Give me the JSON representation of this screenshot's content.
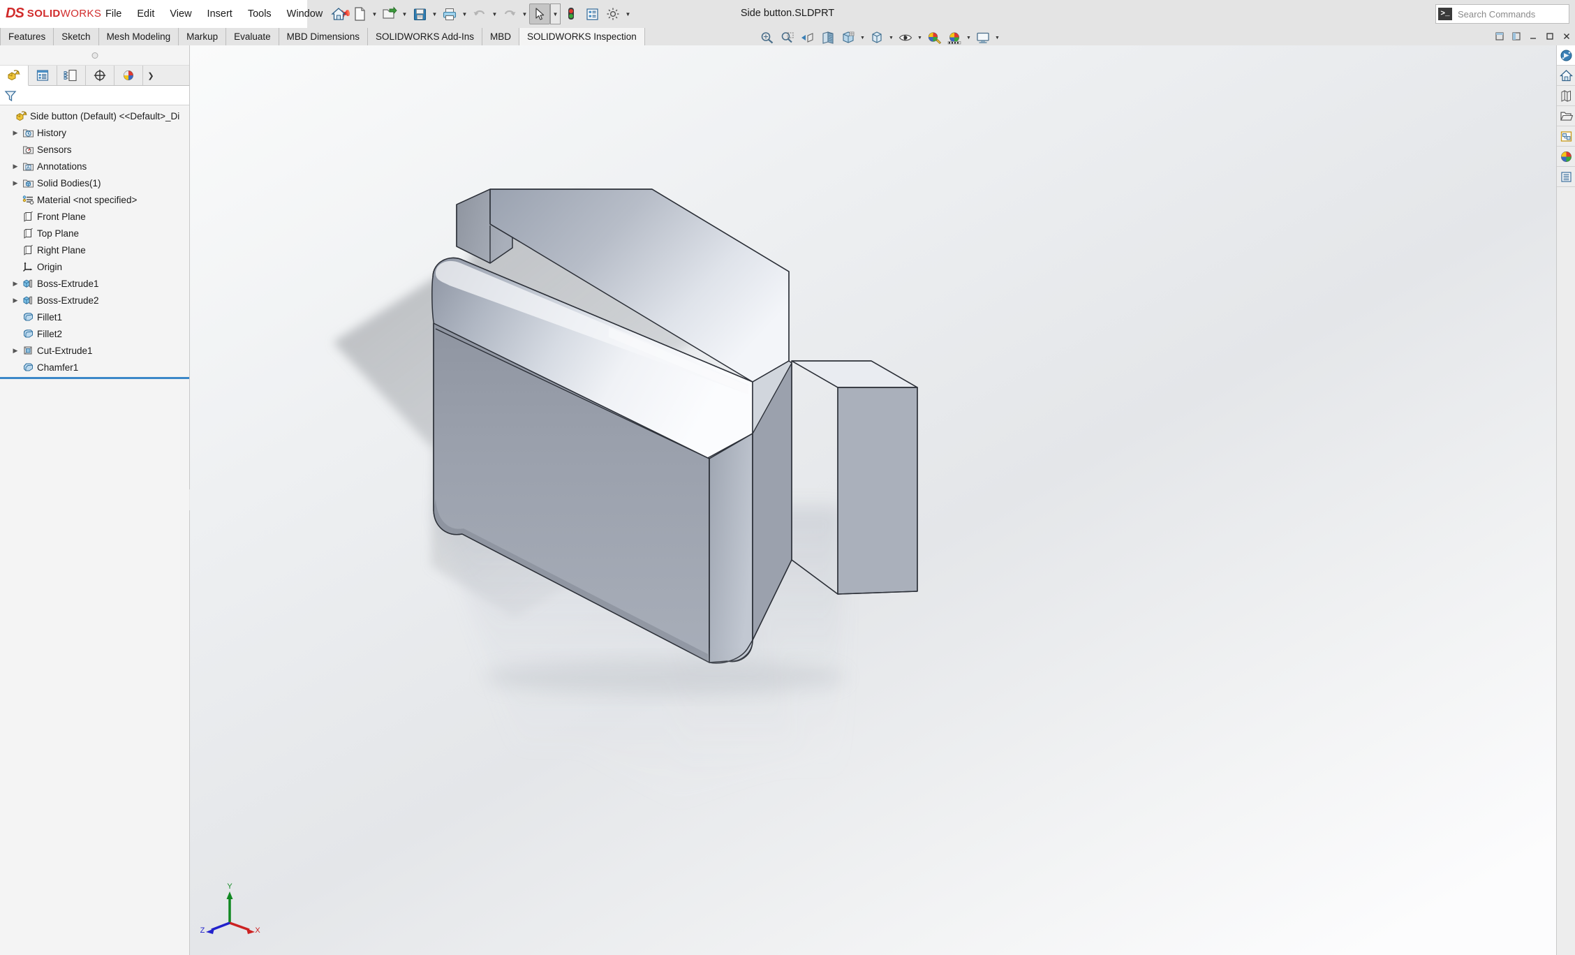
{
  "app": {
    "brand_primary": "DS",
    "brand_bold": "SOLID",
    "brand_thin": "WORKS",
    "document_title": "Side button.SLDPRT",
    "accent_color": "#d12b2b",
    "selection_color": "#3b87c8"
  },
  "menubar": {
    "items": [
      {
        "label": "File",
        "name": "menu-file"
      },
      {
        "label": "Edit",
        "name": "menu-edit"
      },
      {
        "label": "View",
        "name": "menu-view"
      },
      {
        "label": "Insert",
        "name": "menu-insert"
      },
      {
        "label": "Tools",
        "name": "menu-tools"
      },
      {
        "label": "Window",
        "name": "menu-window"
      }
    ],
    "pin_icon": "pushpin-icon"
  },
  "toolbar": {
    "buttons": [
      {
        "icon": "home-icon",
        "caret": false
      },
      {
        "icon": "new-document-icon",
        "caret": true
      },
      {
        "icon": "open-folder-icon",
        "caret": true
      },
      {
        "icon": "save-floppy-icon",
        "caret": true
      },
      {
        "icon": "print-icon",
        "caret": true
      },
      {
        "icon": "undo-icon",
        "caret": true
      },
      {
        "icon": "redo-icon",
        "caret": true
      },
      {
        "icon": "select-arrow-icon",
        "caret": true
      },
      {
        "icon": "rebuild-traffic-light-icon",
        "caret": false
      },
      {
        "icon": "file-properties-icon",
        "caret": false
      },
      {
        "icon": "options-gear-icon",
        "caret": true
      }
    ]
  },
  "search": {
    "placeholder": "Search Commands",
    "icon": "search-prompt-icon"
  },
  "command_tabs": {
    "items": [
      {
        "label": "Features",
        "name": "tab-features",
        "active": false
      },
      {
        "label": "Sketch",
        "name": "tab-sketch",
        "active": false
      },
      {
        "label": "Mesh Modeling",
        "name": "tab-mesh-modeling",
        "active": false
      },
      {
        "label": "Markup",
        "name": "tab-markup",
        "active": false
      },
      {
        "label": "Evaluate",
        "name": "tab-evaluate",
        "active": false
      },
      {
        "label": "MBD Dimensions",
        "name": "tab-mbd-dimensions",
        "active": false
      },
      {
        "label": "SOLIDWORKS Add-Ins",
        "name": "tab-solidworks-add-ins",
        "active": false
      },
      {
        "label": "MBD",
        "name": "tab-mbd",
        "active": false
      },
      {
        "label": "SOLIDWORKS Inspection",
        "name": "tab-solidworks-inspection",
        "active": true
      }
    ]
  },
  "window_controls": [
    {
      "icon": "restore-pane-icon",
      "name": "restore-pane-button"
    },
    {
      "icon": "expand-pane-icon",
      "name": "expand-pane-button"
    },
    {
      "icon": "minimize-icon",
      "name": "minimize-button"
    },
    {
      "icon": "maximize-icon",
      "name": "maximize-button"
    },
    {
      "icon": "close-icon",
      "name": "close-button"
    }
  ],
  "heads_up_view_toolbar": {
    "buttons": [
      {
        "icon": "zoom-to-fit-icon",
        "name": "zoom-to-fit-button",
        "caret": false
      },
      {
        "icon": "zoom-to-area-icon",
        "name": "zoom-to-area-button",
        "caret": false
      },
      {
        "icon": "previous-view-icon",
        "name": "previous-view-button",
        "caret": false
      },
      {
        "icon": "section-view-icon",
        "name": "section-view-button",
        "caret": false
      },
      {
        "icon": "view-orientation-icon",
        "name": "view-orientation-button",
        "caret": false
      },
      {
        "icon": "display-style-icon",
        "name": "display-style-button",
        "caret": true
      },
      {
        "icon": "hide-show-items-icon",
        "name": "hide-show-items-button",
        "caret": true
      },
      {
        "icon": "edit-appearance-icon",
        "name": "edit-appearance-button",
        "caret": false
      },
      {
        "icon": "apply-scene-icon",
        "name": "apply-scene-button",
        "caret": true
      },
      {
        "icon": "view-settings-icon",
        "name": "view-settings-button",
        "caret": true
      }
    ]
  },
  "feature_manager": {
    "panel_tabs": [
      {
        "icon": "feature-manager-tree-icon",
        "name": "tab-feature-manager",
        "active": true
      },
      {
        "icon": "property-manager-icon",
        "name": "tab-property-manager",
        "active": false
      },
      {
        "icon": "configuration-manager-icon",
        "name": "tab-configuration-manager",
        "active": false
      },
      {
        "icon": "dimxpert-manager-icon",
        "name": "tab-dimxpert-manager",
        "active": false
      },
      {
        "icon": "display-manager-icon",
        "name": "tab-display-manager",
        "active": false
      },
      {
        "icon": "inspection-manager-icon",
        "name": "tab-inspection-manager",
        "active": false
      }
    ],
    "more_tabs_icon": "chevron-right-icon",
    "filter_icon": "filter-funnel-icon",
    "tree": [
      {
        "label": "Side button (Default) <<Default>_Di",
        "icon": "part-icon",
        "arrow": false,
        "indent": 0,
        "name": "tree-item-part-root"
      },
      {
        "label": "History",
        "icon": "history-icon",
        "arrow": true,
        "indent": 1,
        "name": "tree-item-history"
      },
      {
        "label": "Sensors",
        "icon": "sensors-icon",
        "arrow": false,
        "indent": 1,
        "name": "tree-item-sensors"
      },
      {
        "label": "Annotations",
        "icon": "annotations-icon",
        "arrow": true,
        "indent": 1,
        "name": "tree-item-annotations"
      },
      {
        "label": "Solid Bodies(1)",
        "icon": "solid-bodies-icon",
        "arrow": true,
        "indent": 1,
        "name": "tree-item-solid-bodies"
      },
      {
        "label": "Material <not specified>",
        "icon": "material-icon",
        "arrow": false,
        "indent": 1,
        "name": "tree-item-material"
      },
      {
        "label": "Front Plane",
        "icon": "plane-icon",
        "arrow": false,
        "indent": 1,
        "name": "tree-item-front-plane"
      },
      {
        "label": "Top Plane",
        "icon": "plane-icon",
        "arrow": false,
        "indent": 1,
        "name": "tree-item-top-plane"
      },
      {
        "label": "Right Plane",
        "icon": "plane-icon",
        "arrow": false,
        "indent": 1,
        "name": "tree-item-right-plane"
      },
      {
        "label": "Origin",
        "icon": "origin-icon",
        "arrow": false,
        "indent": 1,
        "name": "tree-item-origin"
      },
      {
        "label": "Boss-Extrude1",
        "icon": "boss-extrude-icon",
        "arrow": true,
        "indent": 1,
        "name": "tree-item-boss-extrude1"
      },
      {
        "label": "Boss-Extrude2",
        "icon": "boss-extrude-icon",
        "arrow": true,
        "indent": 1,
        "name": "tree-item-boss-extrude2"
      },
      {
        "label": "Fillet1",
        "icon": "fillet-icon",
        "arrow": false,
        "indent": 1,
        "name": "tree-item-fillet1"
      },
      {
        "label": "Fillet2",
        "icon": "fillet-icon",
        "arrow": false,
        "indent": 1,
        "name": "tree-item-fillet2"
      },
      {
        "label": "Cut-Extrude1",
        "icon": "cut-extrude-icon",
        "arrow": true,
        "indent": 1,
        "name": "tree-item-cut-extrude1"
      },
      {
        "label": "Chamfer1",
        "icon": "chamfer-icon",
        "arrow": false,
        "indent": 1,
        "name": "tree-item-chamfer1"
      }
    ]
  },
  "task_pane": {
    "buttons": [
      {
        "icon": "solidworks-resources-icon",
        "name": "task-pane-resources",
        "active": true
      },
      {
        "icon": "design-library-home-icon",
        "name": "task-pane-design-library",
        "active": false
      },
      {
        "icon": "file-explorer-icon",
        "name": "task-pane-file-explorer",
        "active": false
      },
      {
        "icon": "view-palette-icon",
        "name": "task-pane-view-palette",
        "active": false
      },
      {
        "icon": "appearances-scenes-icon",
        "name": "task-pane-appearances",
        "active": false
      },
      {
        "icon": "custom-properties-icon",
        "name": "task-pane-custom-properties",
        "active": false
      },
      {
        "icon": "document-list-icon",
        "name": "task-pane-document-list",
        "active": false
      }
    ]
  },
  "triad": {
    "x_label": "X",
    "y_label": "Y",
    "z_label": "Z",
    "x_color": "#cc2222",
    "y_color": "#118822",
    "z_color": "#2222cc"
  },
  "model": {
    "name": "Side button",
    "description": "Shaded isometric solid part with rounded fillets, chamfer and step cut, reflected on a glossy floor"
  }
}
